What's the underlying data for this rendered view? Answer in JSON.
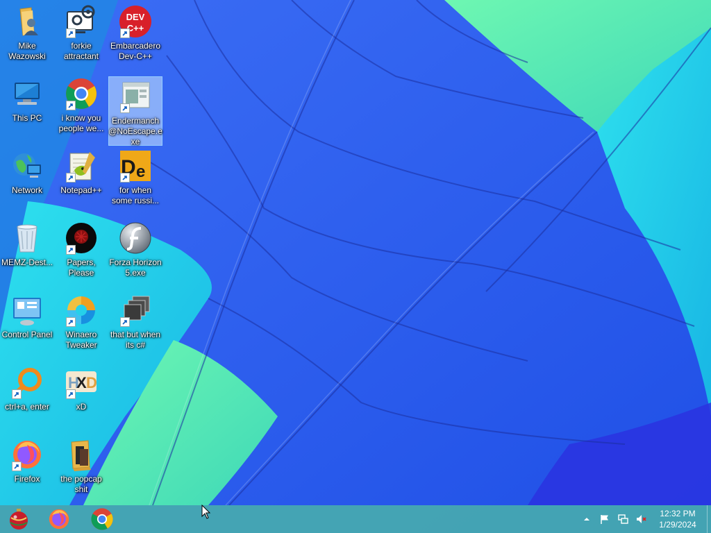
{
  "colors": {
    "wallpaper_blue": "#1f5bf0",
    "wallpaper_cyan": "#22d0e8",
    "wallpaper_green": "#52f0a8",
    "taskbar": "#46aab0",
    "selection": "#cce8ff"
  },
  "desktop": {
    "icons": [
      {
        "label": "Mike Wazowski",
        "icon": "folder-user-icon",
        "shortcut": false
      },
      {
        "label": "forkie attractant",
        "icon": "gear-monitor-icon",
        "shortcut": true
      },
      {
        "label": "Embarcadero Dev-C++",
        "icon": "devcpp-icon",
        "shortcut": true
      },
      {
        "label": "This PC",
        "icon": "computer-icon",
        "shortcut": false
      },
      {
        "label": "i know you people we...",
        "icon": "chrome-icon",
        "shortcut": true
      },
      {
        "label": "Endermanch @NoEscape.exe",
        "icon": "window-app-icon",
        "shortcut": true,
        "selected": true
      },
      {
        "label": "Network",
        "icon": "network-globe-icon",
        "shortcut": false
      },
      {
        "label": "Notepad++",
        "icon": "notepadpp-icon",
        "shortcut": true
      },
      {
        "label": "for when some russi...",
        "icon": "de-app-icon",
        "shortcut": true
      },
      {
        "label": "MEMZ-Dest...",
        "icon": "recycle-bin-icon",
        "shortcut": false
      },
      {
        "label": "Papers, Please",
        "icon": "papers-please-icon",
        "shortcut": true
      },
      {
        "label": "Forza Horizon 5.exe",
        "icon": "flash-icon",
        "shortcut": false
      },
      {
        "label": "Control Panel",
        "icon": "control-panel-icon",
        "shortcut": false
      },
      {
        "label": "Winaero Tweaker",
        "icon": "winaero-icon",
        "shortcut": true
      },
      {
        "label": "that but when its c#",
        "icon": "stacked-windows-icon",
        "shortcut": true
      },
      {
        "label": "ctrl+a, enter",
        "icon": "search-lens-icon",
        "shortcut": true
      },
      {
        "label": "xD",
        "icon": "hxd-icon",
        "shortcut": true
      },
      {
        "label": "Firefox",
        "icon": "firefox-icon",
        "shortcut": true
      },
      {
        "label": "the popcap shit",
        "icon": "folder-media-icon",
        "shortcut": false
      }
    ]
  },
  "taskbar": {
    "start_icon": "ornament-start-icon",
    "pinned": [
      {
        "name": "firefox",
        "icon": "firefox-icon"
      },
      {
        "name": "chrome",
        "icon": "chrome-icon"
      }
    ],
    "tray": {
      "icons": [
        "chevron-up-icon",
        "flag-icon",
        "network-icon",
        "speaker-muted-icon"
      ],
      "time": "12:32 PM",
      "date": "1/29/2024"
    }
  }
}
